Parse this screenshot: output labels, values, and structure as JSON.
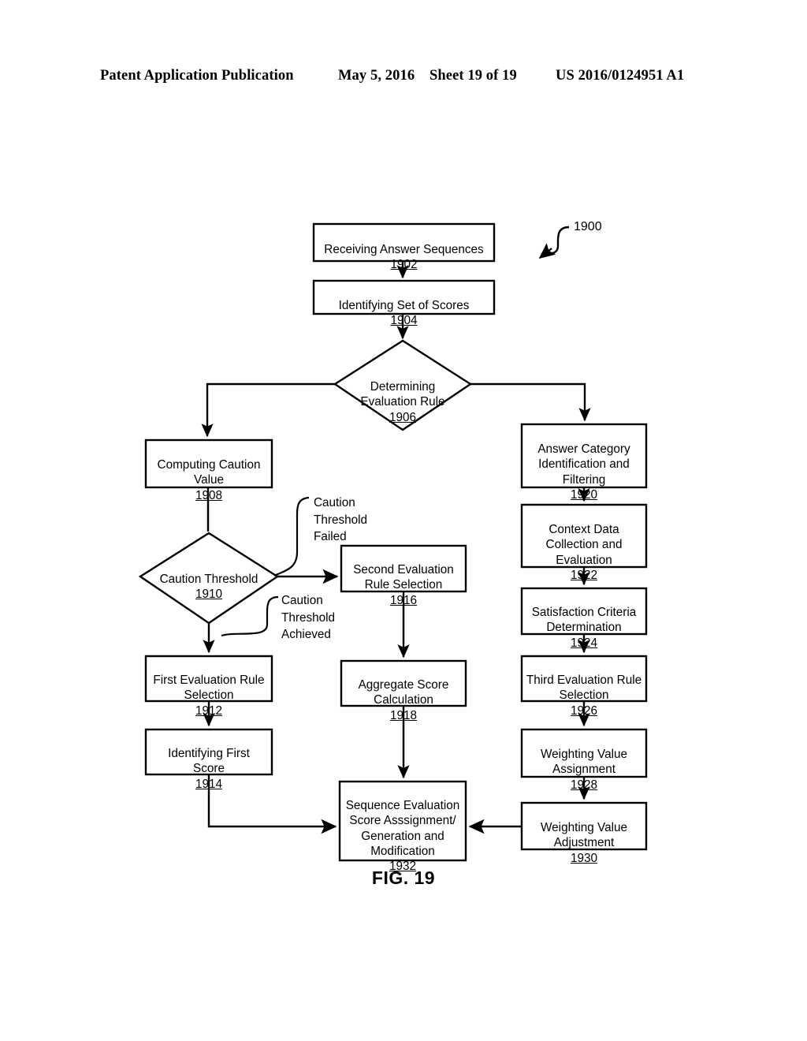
{
  "header": {
    "publication": "Patent Application Publication",
    "date": "May 5, 2016",
    "sheet": "Sheet 19 of 19",
    "patent_number": "US 2016/0124951 A1"
  },
  "figure": {
    "caption": "FIG. 19",
    "diagram_reference": "1900",
    "type": "flowchart"
  },
  "nodes": [
    {
      "id": "n1902",
      "shape": "rect",
      "label": "Receiving Answer Sequences",
      "ref": "1902"
    },
    {
      "id": "n1904",
      "shape": "rect",
      "label": "Identifying Set of Scores",
      "ref": "1904"
    },
    {
      "id": "n1906",
      "shape": "diamond",
      "label": "Determining\nEvaluation Rule",
      "ref": "1906"
    },
    {
      "id": "n1908",
      "shape": "rect",
      "label": "Computing Caution\nValue",
      "ref": "1908"
    },
    {
      "id": "n1910",
      "shape": "diamond",
      "label": "Caution Threshold",
      "ref": "1910"
    },
    {
      "id": "n1912",
      "shape": "rect",
      "label": "First Evaluation Rule\nSelection",
      "ref": "1912"
    },
    {
      "id": "n1914",
      "shape": "rect",
      "label": "Identifying First\nScore",
      "ref": "1914"
    },
    {
      "id": "n1916",
      "shape": "rect",
      "label": "Second Evaluation\nRule Selection",
      "ref": "1916"
    },
    {
      "id": "n1918",
      "shape": "rect",
      "label": "Aggregate Score\nCalculation",
      "ref": "1918"
    },
    {
      "id": "n1920",
      "shape": "rect",
      "label": "Answer Category\nIdentification and\nFiltering",
      "ref": "1920"
    },
    {
      "id": "n1922",
      "shape": "rect",
      "label": "Context Data\nCollection and\nEvaluation",
      "ref": "1922"
    },
    {
      "id": "n1924",
      "shape": "rect",
      "label": "Satisfaction Criteria\nDetermination",
      "ref": "1924"
    },
    {
      "id": "n1926",
      "shape": "rect",
      "label": "Third Evaluation Rule\nSelection",
      "ref": "1926"
    },
    {
      "id": "n1928",
      "shape": "rect",
      "label": "Weighting Value\nAssignment",
      "ref": "1928"
    },
    {
      "id": "n1930",
      "shape": "rect",
      "label": "Weighting Value\nAdjustment",
      "ref": "1930"
    },
    {
      "id": "n1932",
      "shape": "rect",
      "label": "Sequence Evaluation\nScore Asssignment/\nGeneration and\nModification",
      "ref": "1932"
    }
  ],
  "edge_labels": [
    {
      "id": "e-failed",
      "text": "Caution\nThreshold\nFailed"
    },
    {
      "id": "e-achieved",
      "text": "Caution\nThreshold\nAchieved"
    }
  ],
  "style": {
    "stroke": "#000000",
    "fill": "#ffffff",
    "background": "#ffffff"
  }
}
